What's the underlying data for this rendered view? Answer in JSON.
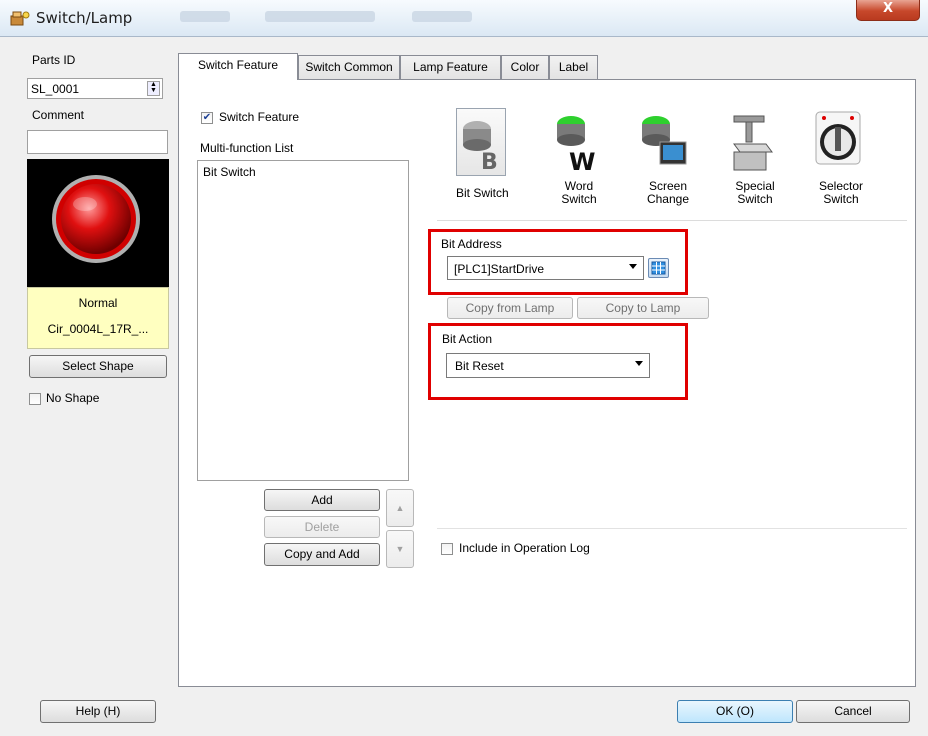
{
  "window": {
    "title": "Switch/Lamp",
    "close_label": "X"
  },
  "left": {
    "parts_id_label": "Parts ID",
    "parts_id_value": "SL_0001",
    "comment_label": "Comment",
    "comment_value": "",
    "shape_state": "Normal",
    "shape_name": "Cir_0004L_17R_...",
    "select_shape_label": "Select Shape",
    "no_shape_label": "No Shape",
    "no_shape_checked": false
  },
  "tabs": [
    "Switch Feature",
    "Switch Common",
    "Lamp Feature",
    "Color",
    "Label"
  ],
  "switch_feature": {
    "checkbox_label": "Switch Feature",
    "checked": true,
    "list_label": "Multi-function List",
    "list_items": [
      "Bit Switch"
    ],
    "add_label": "Add",
    "delete_label": "Delete",
    "copy_add_label": "Copy and Add"
  },
  "types": [
    {
      "line1": "Bit Switch",
      "line2": "",
      "icon": "bit-switch-icon"
    },
    {
      "line1": "Word",
      "line2": "Switch",
      "icon": "word-switch-icon"
    },
    {
      "line1": "Screen",
      "line2": "Change",
      "icon": "screen-change-icon"
    },
    {
      "line1": "Special",
      "line2": "Switch",
      "icon": "special-switch-icon"
    },
    {
      "line1": "Selector",
      "line2": "Switch",
      "icon": "selector-switch-icon"
    }
  ],
  "bit_address": {
    "label": "Bit Address",
    "value": "[PLC1]StartDrive"
  },
  "copy_from_lamp_label": "Copy from Lamp",
  "copy_to_lamp_label": "Copy to Lamp",
  "bit_action": {
    "label": "Bit Action",
    "value": "Bit Reset"
  },
  "include_log_label": "Include in Operation Log",
  "footer": {
    "help_label": "Help (H)",
    "ok_label": "OK (O)",
    "cancel_label": "Cancel"
  },
  "colors": {
    "highlight_red": "#e00000",
    "lamp_red": "#e01010",
    "lamp_bg": "#000000",
    "label_bg": "#ffffc0"
  }
}
